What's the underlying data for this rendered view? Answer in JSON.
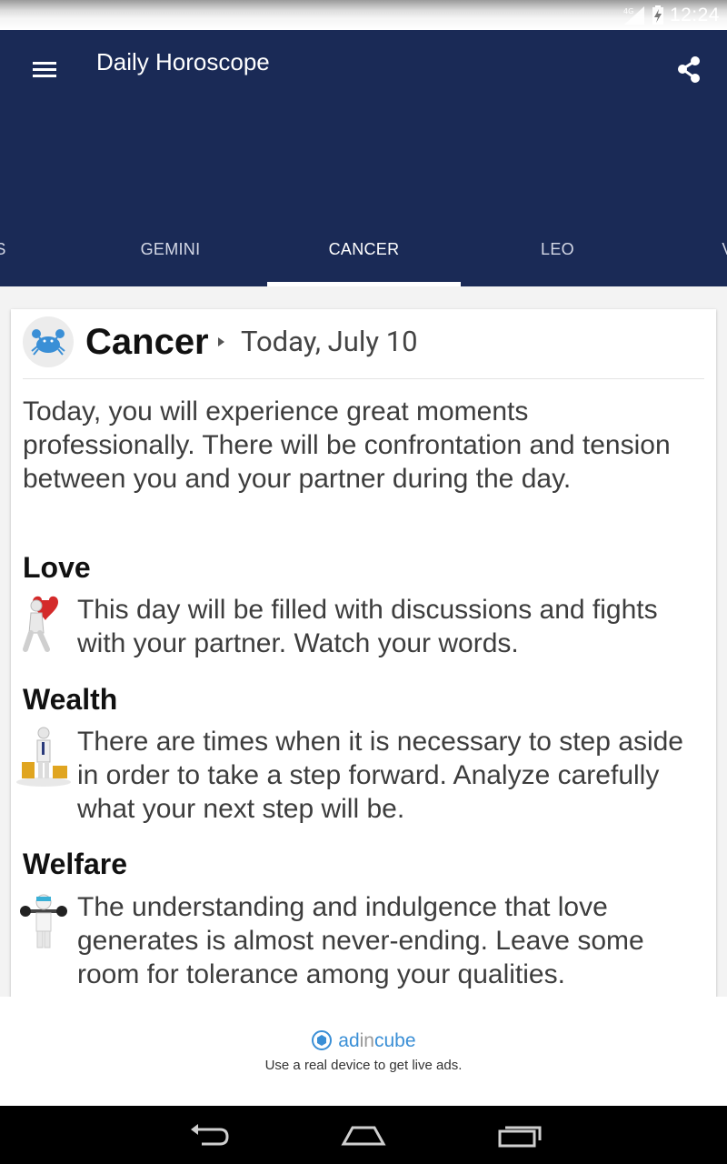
{
  "status_bar": {
    "network": "4G",
    "time": "12:24"
  },
  "app_bar": {
    "title": "Daily Horoscope",
    "menu_icon": "hamburger-menu-icon",
    "share_icon": "share-icon"
  },
  "tabs": [
    {
      "label": "S",
      "active": false
    },
    {
      "label": "GEMINI",
      "active": false
    },
    {
      "label": "CANCER",
      "active": true
    },
    {
      "label": "LEO",
      "active": false
    },
    {
      "label": "V",
      "active": false
    }
  ],
  "card": {
    "sign_icon": "cancer-crab-icon",
    "sign_name": "Cancer",
    "date": "Today, July 10",
    "summary": "Today, you will experience great moments professionally. There will be confrontation and tension between you and your partner during the day.",
    "sections": [
      {
        "title": "Love",
        "icon": "heart-person-icon",
        "text": "This day will be filled with discussions and fights with your partner. Watch your words."
      },
      {
        "title": "Wealth",
        "icon": "money-person-icon",
        "text": "There are times when it is necessary to step aside in order to take a step forward. Analyze carefully what your next step will be."
      },
      {
        "title": "Welfare",
        "icon": "weightlifter-icon",
        "text": "The understanding and indulgence that love generates is almost never-ending. Leave some room for tolerance among your qualities."
      }
    ]
  },
  "ad": {
    "brand_part1": "ad",
    "brand_part2": "in",
    "brand_part3": "cube",
    "text": "Use a real device to get live ads."
  },
  "nav": {
    "back_icon": "back-icon",
    "home_icon": "home-icon",
    "recents_icon": "recents-icon"
  },
  "colors": {
    "app_bar": "#1a2a56",
    "tab_indicator": "#ffffff",
    "ad_brand": "#3a8fd6"
  }
}
